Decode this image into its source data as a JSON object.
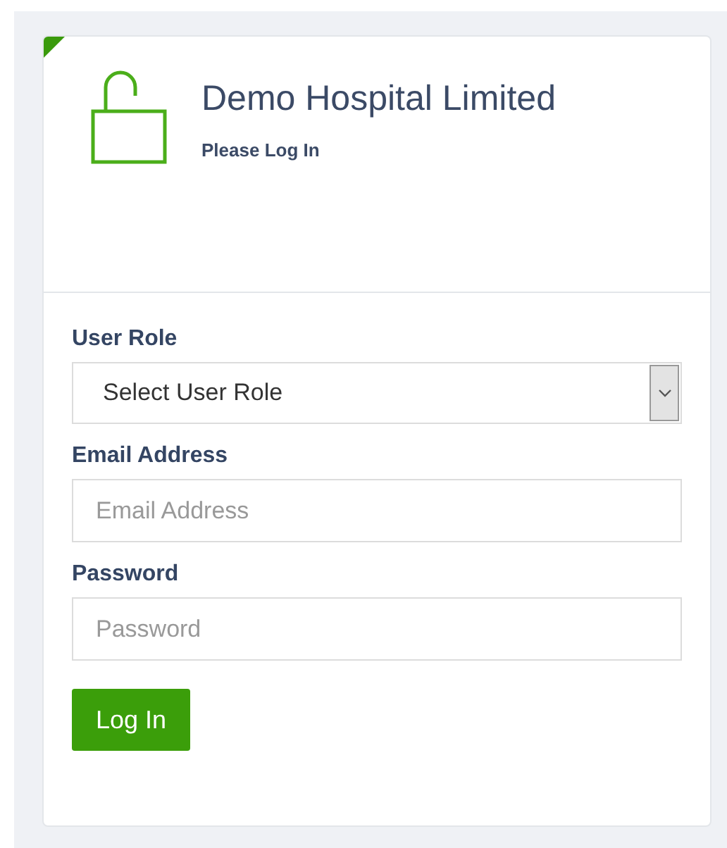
{
  "header": {
    "title": "Demo Hospital Limited",
    "subtitle": "Please Log In"
  },
  "fields": [
    {
      "kind": "select",
      "label": "User Role",
      "value": "Select User Role"
    },
    {
      "kind": "input",
      "label": "Email Address",
      "placeholder": "Email Address"
    },
    {
      "kind": "input",
      "label": "Password",
      "placeholder": "Password"
    }
  ],
  "submit": "Log In"
}
